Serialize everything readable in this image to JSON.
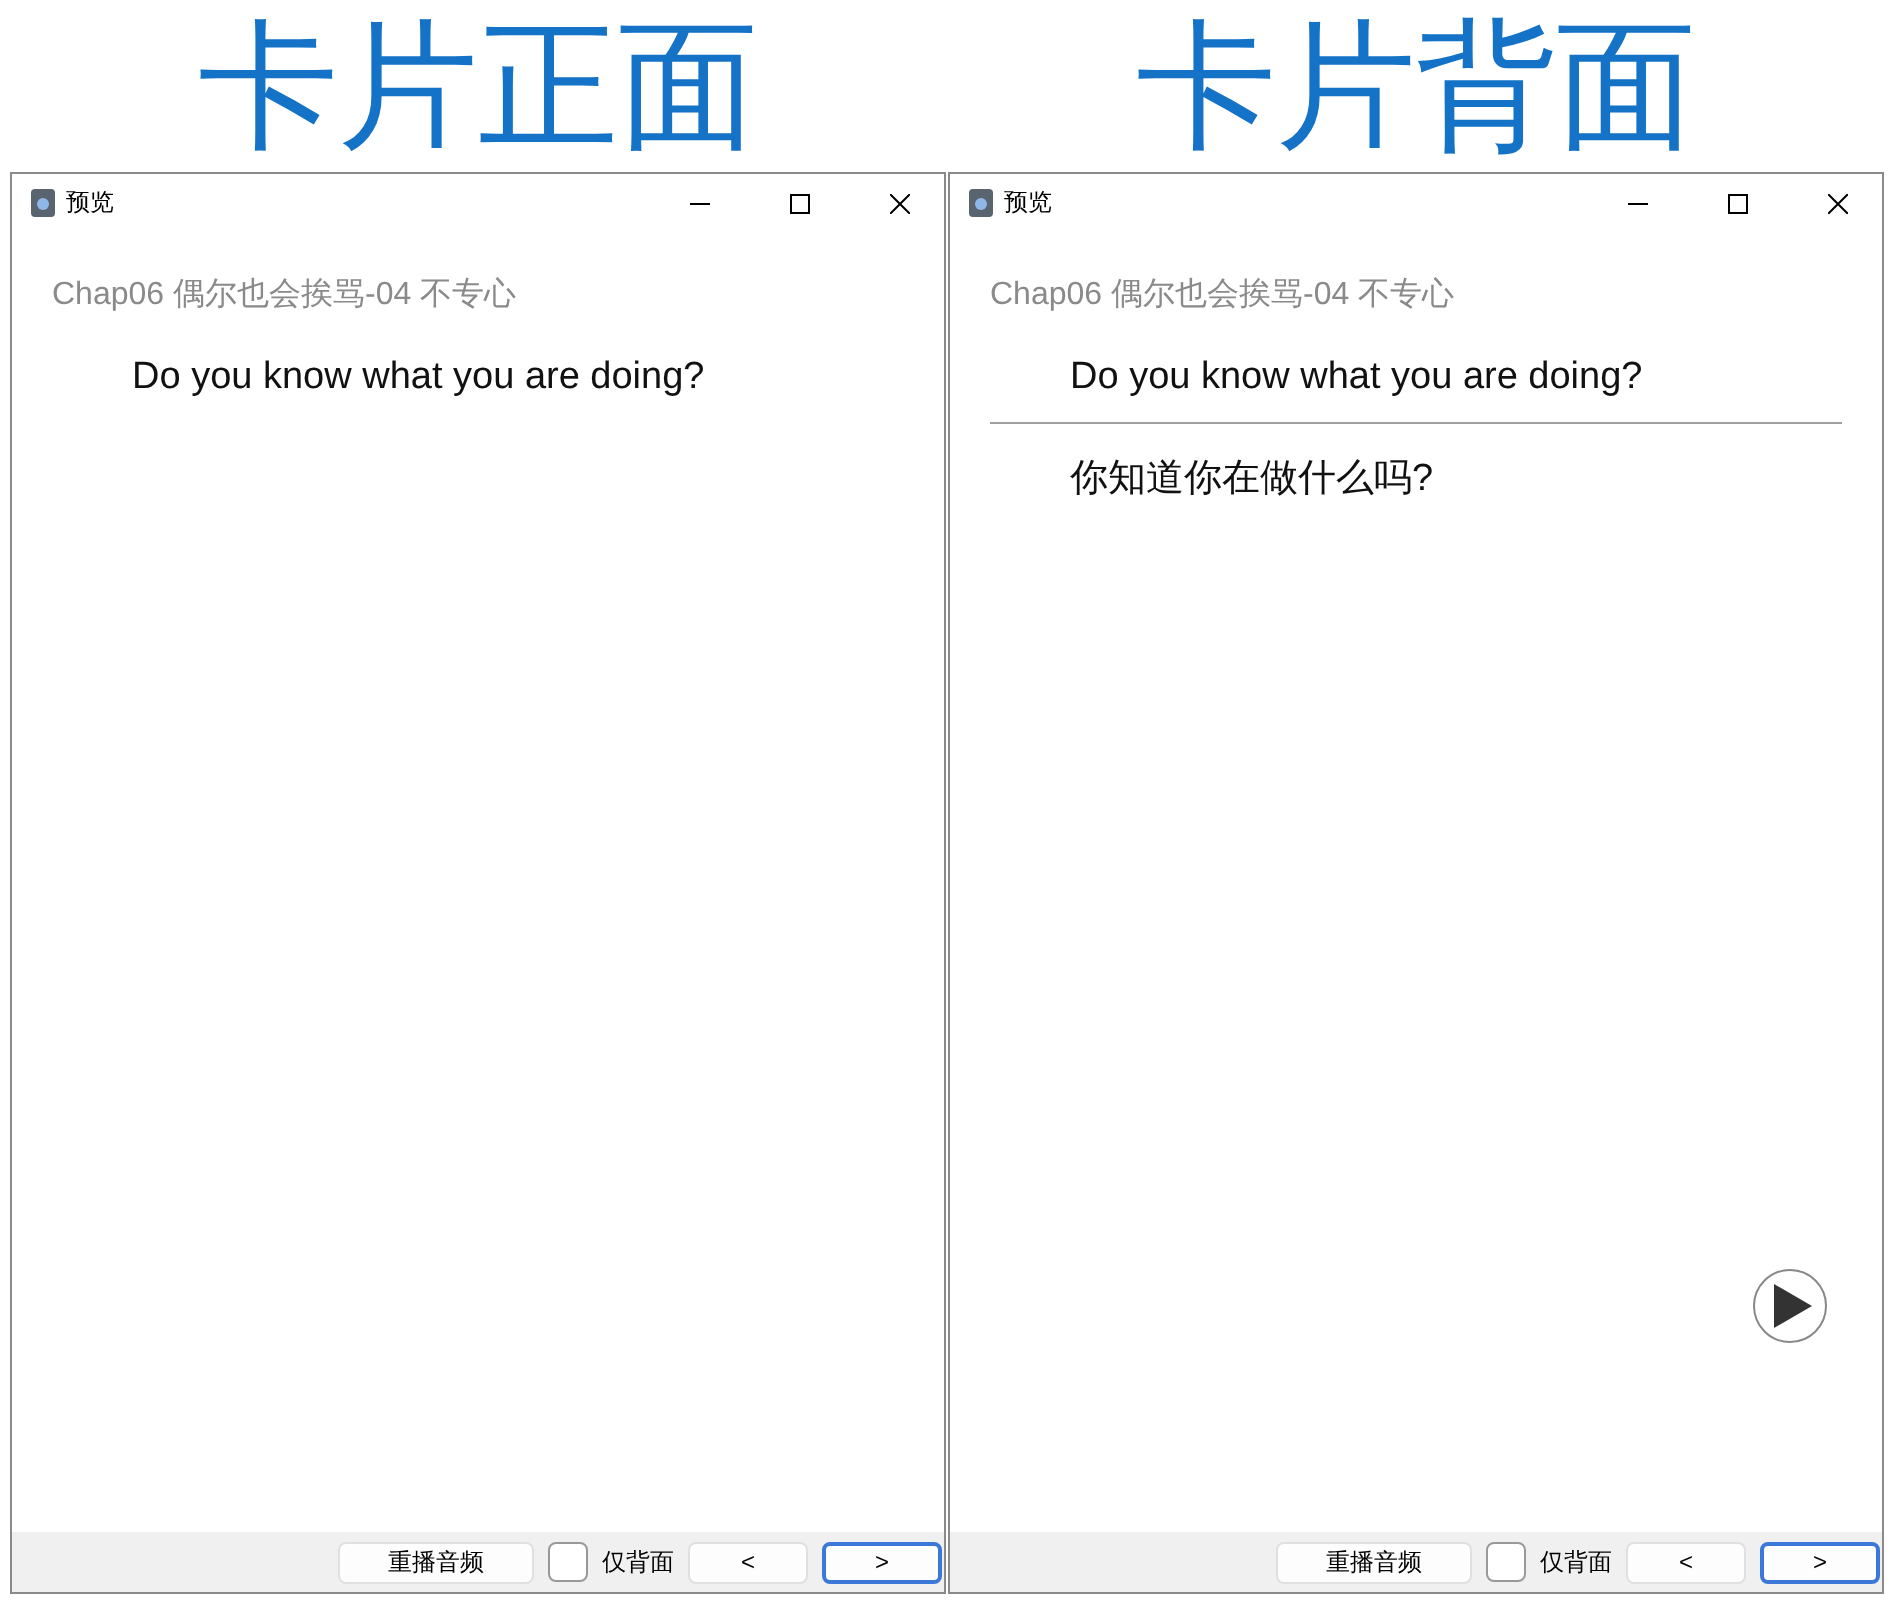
{
  "panels": [
    {
      "heading": "卡片正面",
      "window": {
        "title": "预览",
        "deck_title": "Chap06 偶尔也会挨骂-04 不专心",
        "question": "Do you know what you are doing?",
        "replay_button": "重播音频",
        "back_only": {
          "label": "仅背面",
          "checked": false
        },
        "prev_button": "<",
        "next_button": ">"
      }
    },
    {
      "heading": "卡片背面",
      "window": {
        "title": "预览",
        "deck_title": "Chap06 偶尔也会挨骂-04 不专心",
        "question": "Do you know what you are doing?",
        "answer": "你知道你在做什么吗?",
        "play_button": true,
        "replay_button": "重播音频",
        "back_only": {
          "label": "仅背面",
          "checked": false
        },
        "prev_button": "<",
        "next_button": ">"
      }
    }
  ]
}
